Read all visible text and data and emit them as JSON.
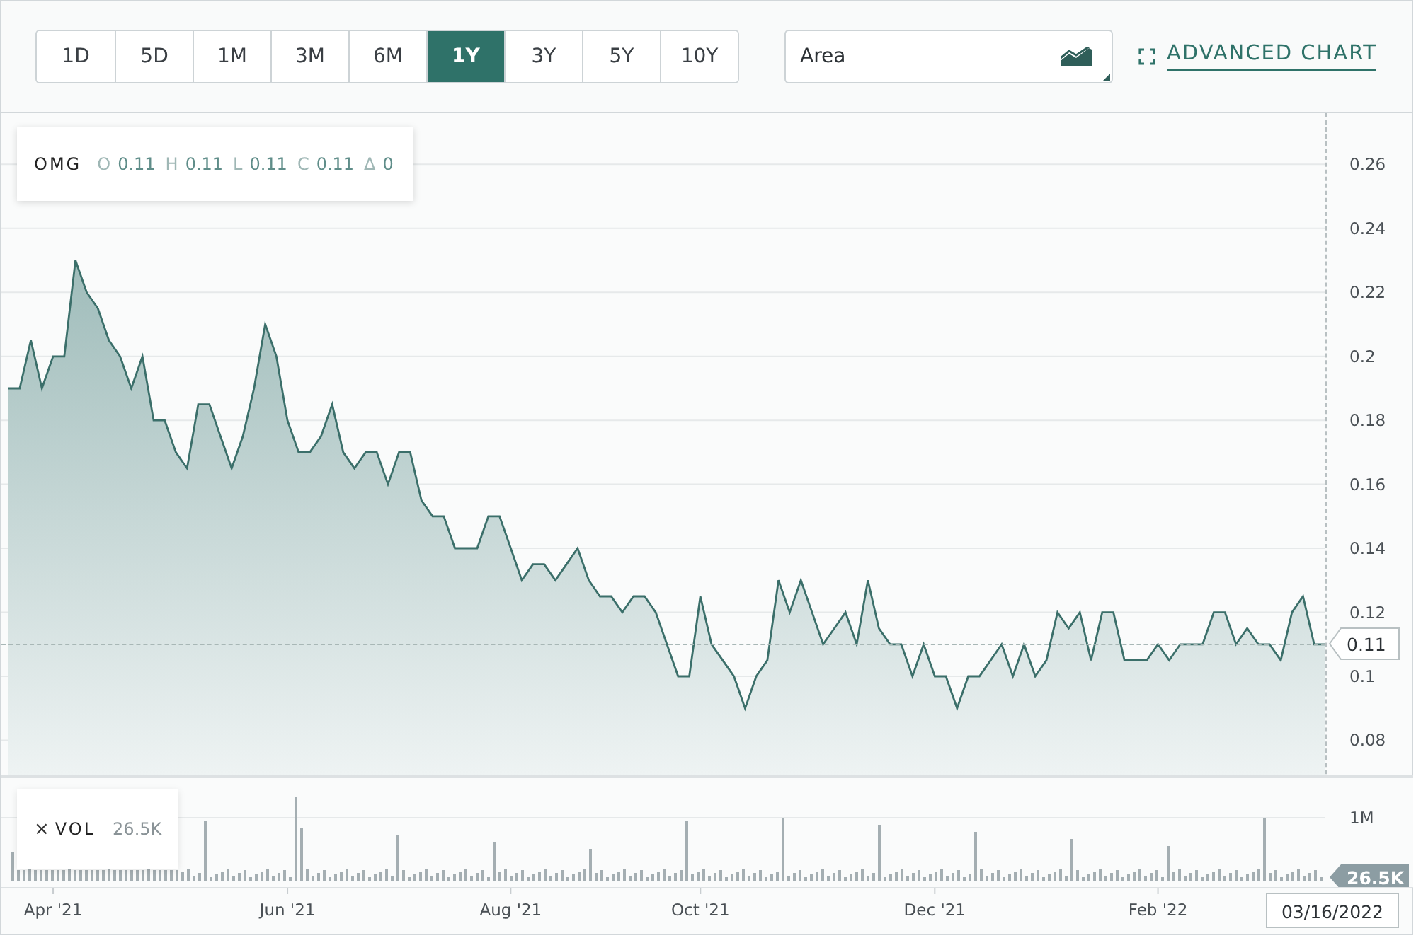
{
  "toolbar": {
    "ranges": [
      {
        "label": "1D",
        "selected": false
      },
      {
        "label": "5D",
        "selected": false
      },
      {
        "label": "1M",
        "selected": false
      },
      {
        "label": "3M",
        "selected": false
      },
      {
        "label": "6M",
        "selected": false
      },
      {
        "label": "1Y",
        "selected": true
      },
      {
        "label": "3Y",
        "selected": false
      },
      {
        "label": "5Y",
        "selected": false
      },
      {
        "label": "10Y",
        "selected": false
      }
    ],
    "chart_type": {
      "value": "Area"
    },
    "advanced_chart": {
      "label": "ADVANCED CHART"
    }
  },
  "price_tag": "0.11",
  "legend": {
    "fields": [
      {
        "label": "O",
        "value": "0.11"
      },
      {
        "label": "H",
        "value": "0.11"
      },
      {
        "label": "L",
        "value": "0.11"
      },
      {
        "label": "C",
        "value": "0.11"
      },
      {
        "label": "Δ",
        "value": "0"
      }
    ]
  },
  "chart_data": {
    "type": "area",
    "categories": [
      null,
      null,
      null,
      null,
      "Apr '21",
      null,
      null,
      null,
      null,
      null,
      null,
      null,
      null,
      null,
      null,
      null,
      null,
      null,
      null,
      null,
      null,
      null,
      null,
      null,
      null,
      "Jun '21",
      null,
      null,
      null,
      null,
      null,
      null,
      null,
      null,
      null,
      null,
      null,
      null,
      null,
      null,
      null,
      null,
      null,
      null,
      null,
      "Aug '21",
      null,
      null,
      null,
      null,
      null,
      null,
      null,
      null,
      null,
      null,
      null,
      null,
      null,
      null,
      null,
      null,
      "Oct '21",
      null,
      null,
      null,
      null,
      null,
      null,
      null,
      null,
      null,
      null,
      null,
      null,
      null,
      null,
      null,
      null,
      null,
      null,
      null,
      null,
      "Dec '21",
      null,
      null,
      null,
      null,
      null,
      null,
      null,
      null,
      null,
      null,
      null,
      null,
      null,
      null,
      null,
      null,
      null,
      null,
      null,
      "Feb '22",
      null,
      null,
      null,
      null,
      null,
      null,
      null,
      null,
      null,
      null,
      null,
      null,
      null,
      null,
      null
    ],
    "series": [
      {
        "name": "OMG",
        "color": "#3b6f6a",
        "values": [
          0.19,
          0.19,
          0.205,
          0.19,
          0.2,
          0.2,
          0.23,
          0.22,
          0.215,
          0.205,
          0.2,
          0.19,
          0.2,
          0.18,
          0.18,
          0.17,
          0.165,
          0.185,
          0.185,
          0.175,
          0.165,
          0.175,
          0.19,
          0.21,
          0.2,
          0.18,
          0.17,
          0.17,
          0.175,
          0.185,
          0.17,
          0.165,
          0.17,
          0.17,
          0.16,
          0.17,
          0.17,
          0.155,
          0.15,
          0.15,
          0.14,
          0.14,
          0.14,
          0.15,
          0.15,
          0.14,
          0.13,
          0.135,
          0.135,
          0.13,
          0.135,
          0.14,
          0.13,
          0.125,
          0.125,
          0.12,
          0.125,
          0.125,
          0.12,
          0.11,
          0.1,
          0.1,
          0.125,
          0.11,
          0.105,
          0.1,
          0.09,
          0.1,
          0.105,
          0.13,
          0.12,
          0.13,
          0.12,
          0.11,
          0.115,
          0.12,
          0.11,
          0.13,
          0.115,
          0.11,
          0.11,
          0.1,
          0.11,
          0.1,
          0.1,
          0.09,
          0.1,
          0.1,
          0.105,
          0.11,
          0.1,
          0.11,
          0.1,
          0.105,
          0.12,
          0.115,
          0.12,
          0.105,
          0.12,
          0.12,
          0.105,
          0.105,
          0.105,
          0.11,
          0.105,
          0.11,
          0.11,
          0.11,
          0.12,
          0.12,
          0.11,
          0.115,
          0.11,
          0.11,
          0.105,
          0.12,
          0.125,
          0.11,
          0.11
        ]
      }
    ],
    "ylim": [
      0.0341,
      0.276
    ],
    "grid": true,
    "yticks": [
      0.08,
      0.1,
      0.12,
      0.14,
      0.16,
      0.18,
      0.2,
      0.22,
      0.24,
      0.26
    ]
  },
  "volume": {
    "close": "×",
    "label": "VOL",
    "value": "26.5K",
    "axis_label": "1M",
    "tag": "26.5K"
  },
  "date_tag": "03/16/2022"
}
